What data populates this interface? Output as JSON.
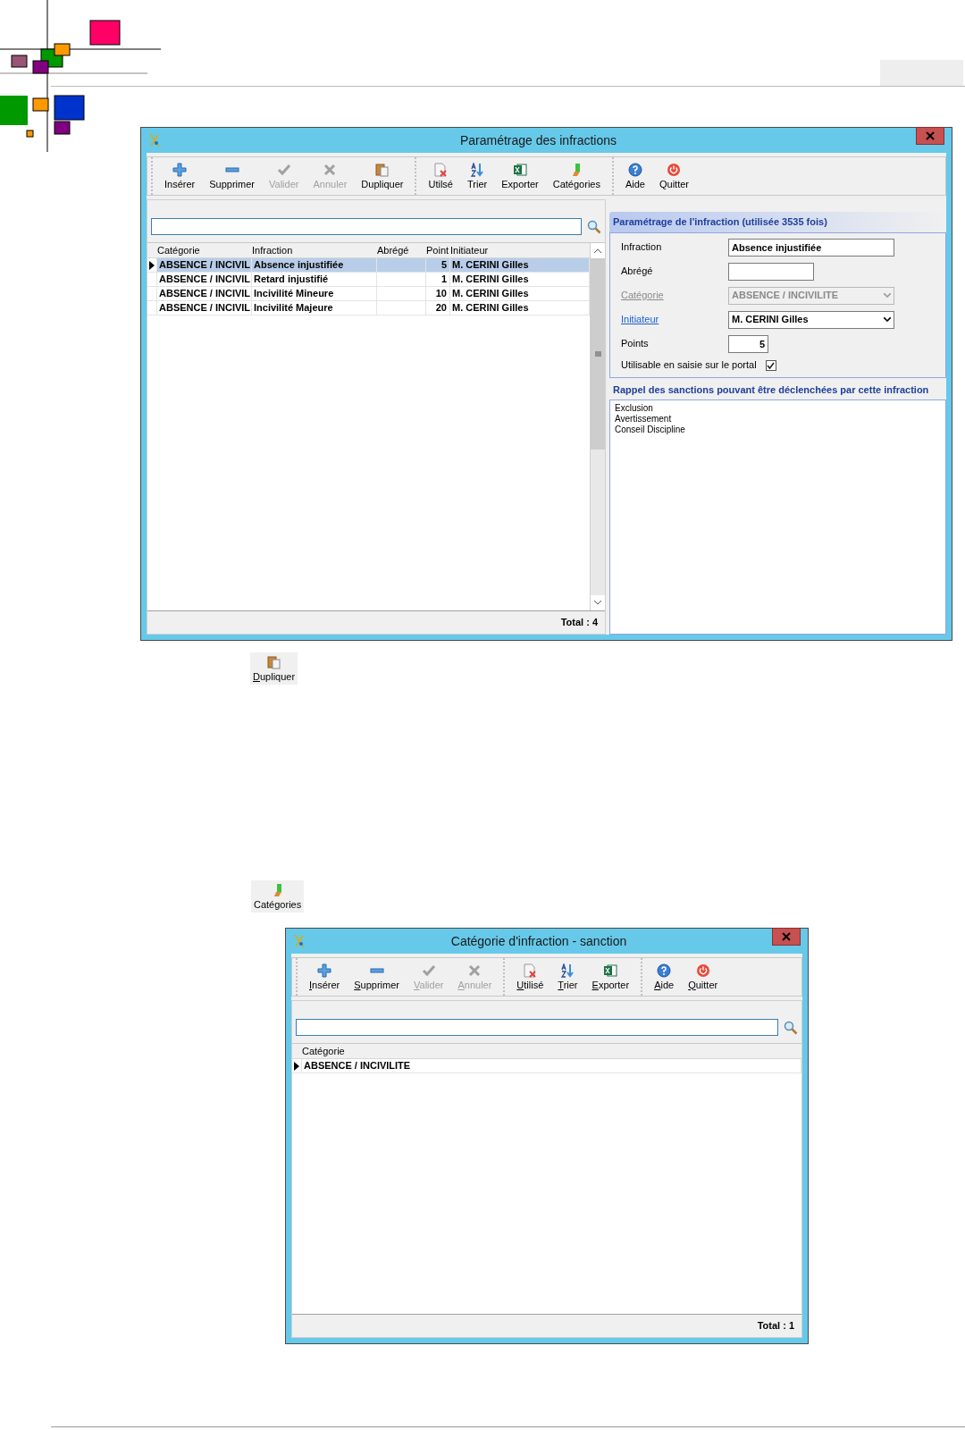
{
  "window_1": {
    "title": "Paramétrage des infractions",
    "access_keys_underlined": false,
    "toolbar": [
      [
        {
          "label": "Insérer",
          "kind": "insert",
          "disabled": false
        },
        {
          "label": "Supprimer",
          "kind": "delete",
          "disabled": false
        },
        {
          "label": "Valider",
          "kind": "validate",
          "disabled": true
        },
        {
          "label": "Annuler",
          "kind": "cancel",
          "disabled": true
        },
        {
          "label": "Dupliquer",
          "kind": "duplicate",
          "disabled": false
        }
      ],
      [
        {
          "label": "Utilsé",
          "kind": "used",
          "disabled": false
        },
        {
          "label": "Trier",
          "kind": "sort",
          "disabled": false
        },
        {
          "label": "Exporter",
          "kind": "export",
          "disabled": false
        },
        {
          "label": "Catégories",
          "kind": "categories",
          "disabled": false
        }
      ],
      [
        {
          "label": "Aide",
          "kind": "help",
          "disabled": false
        },
        {
          "label": "Quitter",
          "kind": "quit",
          "disabled": false
        }
      ]
    ],
    "table": {
      "columns": [
        "Catégorie",
        "Infraction",
        "Abrégé",
        "Point",
        "Initiateur"
      ],
      "rows": [
        {
          "cells": [
            "ABSENCE / INCIVIL",
            "Absence injustifiée",
            "",
            "5",
            "M. CERINI Gilles"
          ],
          "selected": true,
          "current": true
        },
        {
          "cells": [
            "ABSENCE / INCIVIL",
            "Retard injustifié",
            "",
            "1",
            "M. CERINI Gilles"
          ],
          "selected": false,
          "current": false
        },
        {
          "cells": [
            "ABSENCE / INCIVIL",
            "Incivilité Mineure",
            "",
            "10",
            "M. CERINI Gilles"
          ],
          "selected": false,
          "current": false
        },
        {
          "cells": [
            "ABSENCE / INCIVIL",
            "Incivilité Majeure",
            "",
            "20",
            "M. CERINI Gilles"
          ],
          "selected": false,
          "current": false
        }
      ]
    },
    "total": "Total : 4",
    "details": {
      "title": "Paramétrage de l'infraction (utilisée 3535 fois)",
      "fields": [
        {
          "kind": "text",
          "label": "Infraction",
          "value": "Absence injustifiée",
          "link": false,
          "disabled": false
        },
        {
          "kind": "short",
          "label": "Abrégé",
          "link": false,
          "disabled": false
        },
        {
          "kind": "combo",
          "label": "Catégorie",
          "value": "ABSENCE / INCIVILITE",
          "link": true,
          "disabled": true
        },
        {
          "kind": "combo",
          "label": "Initiateur",
          "value": "M. CERINI Gilles",
          "link": true,
          "disabled": false
        },
        {
          "kind": "number",
          "label": "Points",
          "value": "5",
          "link": false,
          "disabled": false
        },
        {
          "kind": "check",
          "label": "Utilisable en saisie sur le portal",
          "checked": true,
          "link": false,
          "disabled": false
        }
      ]
    },
    "sanctions": {
      "title": "Rappel des sanctions pouvant être déclenchées par cette infraction",
      "items": [
        "Exclusion",
        "Avertissement",
        "Conseil Discipline"
      ]
    }
  },
  "duplicate_button": {
    "label": "Dupliquer",
    "kind": "duplicate"
  },
  "categories_button": {
    "label": "Catégories",
    "kind": "categories"
  },
  "window_2": {
    "title": "Catégorie d'infraction - sanction",
    "access_keys_underlined": true,
    "toolbar": [
      [
        {
          "label": "Insérer",
          "kind": "insert",
          "disabled": false
        },
        {
          "label": "Supprimer",
          "kind": "delete",
          "disabled": false
        },
        {
          "label": "Valider",
          "kind": "validate",
          "disabled": true
        },
        {
          "label": "Annuler",
          "kind": "cancel",
          "disabled": true
        }
      ],
      [
        {
          "label": "Utilisé",
          "kind": "used",
          "disabled": false
        },
        {
          "label": "Trier",
          "kind": "sort",
          "disabled": false
        },
        {
          "label": "Exporter",
          "kind": "export",
          "disabled": false
        }
      ],
      [
        {
          "label": "Aide",
          "kind": "help",
          "disabled": false
        },
        {
          "label": "Quitter",
          "kind": "quit",
          "disabled": false
        }
      ]
    ],
    "table": {
      "columns": [
        "Catégorie"
      ],
      "rows": [
        {
          "cells": [
            "ABSENCE / INCIVILITE"
          ],
          "selected": false,
          "current": true
        }
      ]
    },
    "total": "Total : 1"
  }
}
